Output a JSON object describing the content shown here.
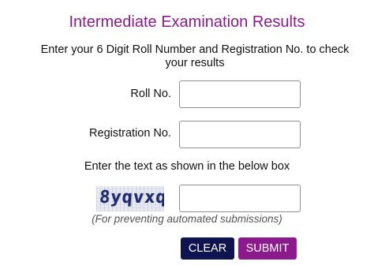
{
  "header": {
    "title": "Intermediate Examination Results"
  },
  "instructions": {
    "line1": "Enter your 6 Digit Roll Number and Registration No. to check",
    "line2": "your results"
  },
  "form": {
    "roll_no": {
      "label": "Roll No.",
      "value": ""
    },
    "registration_no": {
      "label": "Registration No.",
      "value": ""
    },
    "captcha": {
      "prompt": "Enter the text as shown in the below box",
      "image_text": "8yqvxq",
      "value": "",
      "note": "(For preventing automated submissions)"
    }
  },
  "buttons": {
    "clear_label": "CLEAR",
    "submit_label": "SUBMIT"
  },
  "colors": {
    "title": "#8b1a8b",
    "clear_button": "#0e1450",
    "submit_button": "#8d1a8d"
  }
}
